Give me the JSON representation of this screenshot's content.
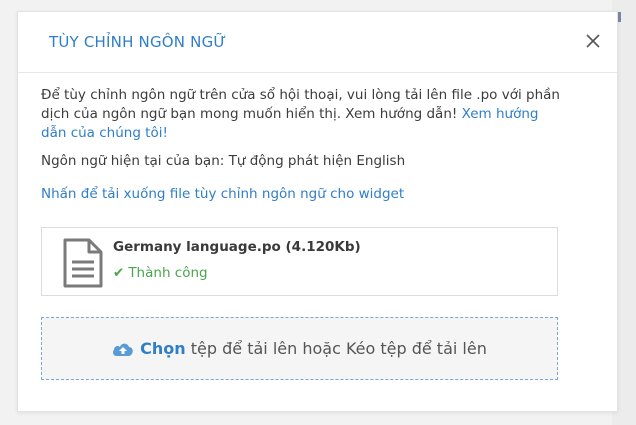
{
  "modal": {
    "title": "TÙY CHỈNH NGÔN NGỮ",
    "close_icon": "close-icon",
    "description_text": "Để tùy chỉnh ngôn ngữ trên cửa sổ hội thoại, vui lòng tải lên file .po với phần dịch của ngôn ngữ bạn mong muốn hiển thị. Xem hướng dẫn!",
    "help_link": "Xem hướng dẫn của chúng tôi!",
    "current_language": "Ngôn ngữ hiện tại của bạn: Tự động phát hiện English",
    "download_link": "Nhấn để tải xuống file tùy chỉnh ngôn ngữ cho widget",
    "file": {
      "name": "Germany language.po (4.120Kb)",
      "status": "Thành công",
      "status_icon": "check-icon",
      "file_icon": "document-icon"
    },
    "dropzone": {
      "choose": "Chọn",
      "rest": " tệp để tải lên hoặc Kéo tệp để tải lên",
      "icon": "cloud-upload-icon"
    }
  },
  "colors": {
    "accent": "#2f7ec9",
    "success": "#4aa64d",
    "border": "#dcdcdc"
  }
}
